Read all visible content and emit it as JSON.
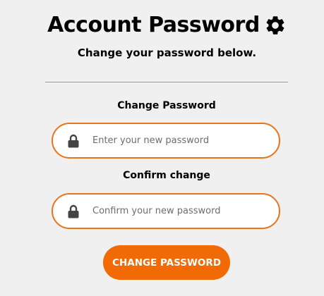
{
  "header": {
    "title": "Account Password",
    "title_icon": "gear-icon",
    "subtitle": "Change your password below."
  },
  "form": {
    "new_password": {
      "label": "Change Password",
      "placeholder": "Enter your new password",
      "value": "",
      "icon": "lock-icon"
    },
    "confirm_password": {
      "label": "Confirm change",
      "placeholder": "Confirm your new password",
      "value": "",
      "icon": "lock-icon"
    },
    "submit_label": "CHANGE PASSWORD"
  },
  "colors": {
    "background": "#f0f0f0",
    "accent": "#f26a06",
    "field_border": "#e8751a",
    "divider": "#9a9a9a"
  }
}
